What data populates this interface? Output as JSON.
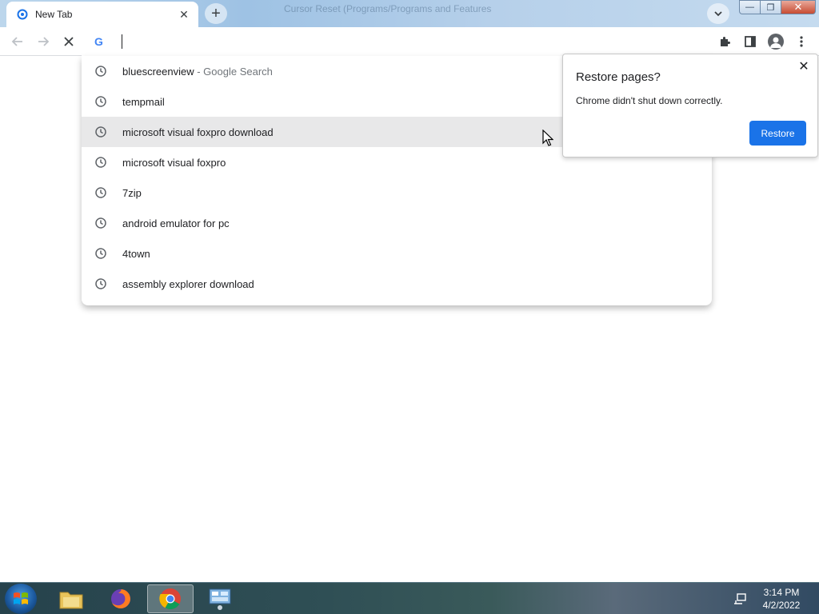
{
  "window": {
    "caption": "Cursor Reset (Programs/Programs and Features",
    "controls": {
      "minimize": "—",
      "maximize": "❐",
      "close": "✕"
    }
  },
  "tab": {
    "title": "New Tab",
    "close": "✕"
  },
  "new_tab_button": "+",
  "omnibox": {
    "value": "",
    "g_letter": "G"
  },
  "suggestions": [
    {
      "text": "bluescreenview",
      "sub": " - Google Search",
      "highlighted": false
    },
    {
      "text": "tempmail",
      "sub": "",
      "highlighted": false
    },
    {
      "text": "microsoft visual foxpro download",
      "sub": "",
      "highlighted": true
    },
    {
      "text": "microsoft visual foxpro",
      "sub": "",
      "highlighted": false
    },
    {
      "text": "7zip",
      "sub": "",
      "highlighted": false
    },
    {
      "text": "android emulator for pc",
      "sub": "",
      "highlighted": false
    },
    {
      "text": "4town",
      "sub": "",
      "highlighted": false
    },
    {
      "text": "assembly explorer download",
      "sub": "",
      "highlighted": false
    }
  ],
  "restore_bubble": {
    "title": "Restore pages?",
    "body": "Chrome didn't shut down correctly.",
    "button": "Restore",
    "close": "✕"
  },
  "taskbar": {
    "apps": [
      "file-explorer",
      "firefox",
      "chrome",
      "control-panel"
    ],
    "active_app": "chrome",
    "time": "3:14 PM",
    "date": "4/2/2022"
  },
  "colors": {
    "accent": "#1a73e8",
    "highlight": "#e8e8e9"
  }
}
